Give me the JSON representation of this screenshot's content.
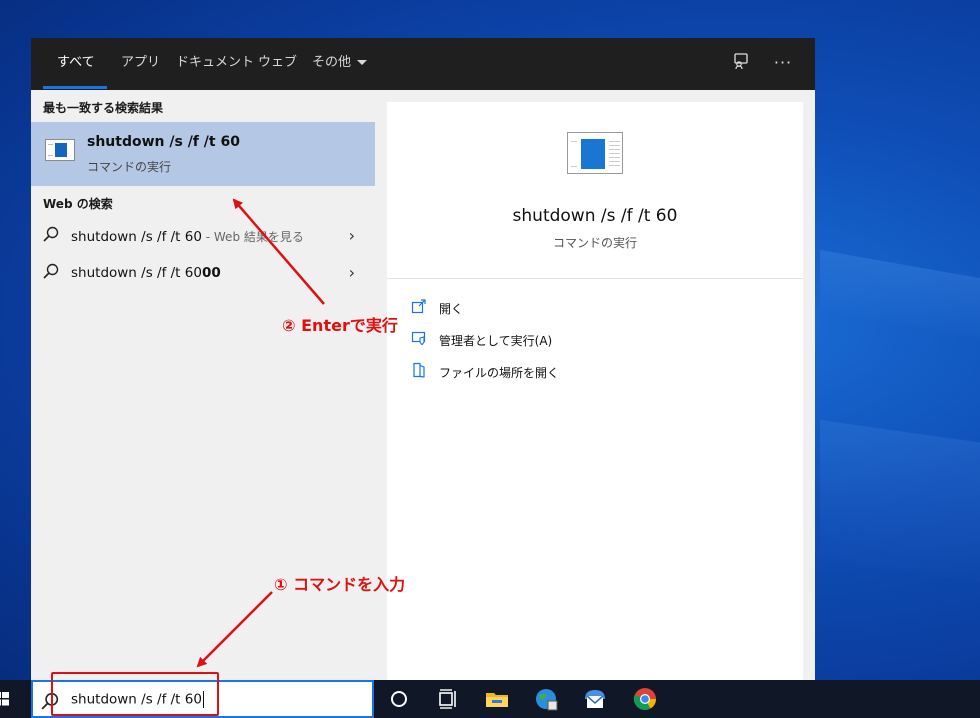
{
  "tabs": {
    "all": "すべて",
    "apps": "アプリ",
    "documents": "ドキュメント",
    "web": "ウェブ",
    "more": "その他"
  },
  "left": {
    "best_match_heading": "最も一致する検索結果",
    "best_match_title": "shutdown /s /f /t 60",
    "best_match_subtitle": "コマンドの実行",
    "web_heading": "Web の検索",
    "web_results": [
      {
        "query": "shutdown /s /f /t 60",
        "suffix": " - Web 結果を見る"
      },
      {
        "query_prefix": "shutdown /s /f /t 60",
        "query_bold": "00"
      }
    ]
  },
  "right": {
    "title": "shutdown /s /f /t 60",
    "subtitle": "コマンドの実行",
    "actions": [
      {
        "label": "開く",
        "icon": "open-icon"
      },
      {
        "label": "管理者として実行(A)",
        "icon": "shield-run-icon"
      },
      {
        "label": "ファイルの場所を開く",
        "icon": "folder-location-icon"
      }
    ]
  },
  "taskbar": {
    "search_value": "shutdown /s /f /t 60"
  },
  "annotations": {
    "step1": "① コマンドを入力",
    "step2": "② Enterで実行"
  },
  "colors": {
    "accent": "#1a73e8",
    "selection": "#b4c8e6",
    "annotation": "#e01010",
    "topbar": "#1f1f1f"
  }
}
